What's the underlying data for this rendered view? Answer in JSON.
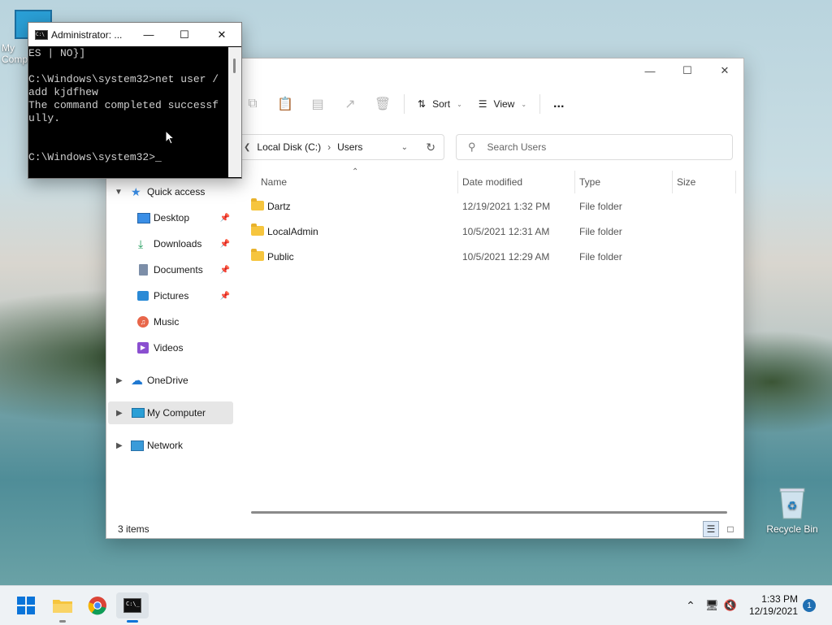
{
  "desktop": {
    "icons": [
      {
        "label": "My Computer",
        "icon": "monitor-icon"
      },
      {
        "label": "Recycle Bin",
        "icon": "recycle-bin-icon"
      }
    ]
  },
  "explorer": {
    "toolbar": {
      "sort_label": "Sort",
      "view_label": "View",
      "more_label": "..."
    },
    "address": {
      "crumbs": [
        "Local Disk (C:)",
        "Users"
      ]
    },
    "search": {
      "placeholder": "Search Users"
    },
    "nav": {
      "quick_access": "Quick access",
      "items": [
        {
          "label": "Desktop",
          "icon": "desktop-icon",
          "pinned": true
        },
        {
          "label": "Downloads",
          "icon": "download-icon",
          "pinned": true
        },
        {
          "label": "Documents",
          "icon": "document-icon",
          "pinned": true
        },
        {
          "label": "Pictures",
          "icon": "picture-icon",
          "pinned": true
        },
        {
          "label": "Music",
          "icon": "music-icon",
          "pinned": false
        },
        {
          "label": "Videos",
          "icon": "video-icon",
          "pinned": false
        }
      ],
      "onedrive": "OneDrive",
      "my_computer": "My Computer",
      "network": "Network"
    },
    "columns": {
      "name": "Name",
      "date": "Date modified",
      "type": "Type",
      "size": "Size"
    },
    "rows": [
      {
        "name": "Dartz",
        "date": "12/19/2021 1:32 PM",
        "type": "File folder"
      },
      {
        "name": "LocalAdmin",
        "date": "10/5/2021 12:31 AM",
        "type": "File folder"
      },
      {
        "name": "Public",
        "date": "10/5/2021 12:29 AM",
        "type": "File folder"
      }
    ],
    "status": "3 items"
  },
  "cmd": {
    "title": "Administrator: ...",
    "lines": [
      "ES | NO}]",
      "",
      "C:\\Windows\\system32>net user /",
      "add kjdfhew",
      "The command completed successf",
      "ully.",
      "",
      "",
      "C:\\Windows\\system32>_"
    ]
  },
  "taskbar": {
    "time": "1:33 PM",
    "date": "12/19/2021",
    "notification_count": "1"
  },
  "colors": {
    "accent": "#0078d4",
    "folder": "#f6c53e"
  }
}
